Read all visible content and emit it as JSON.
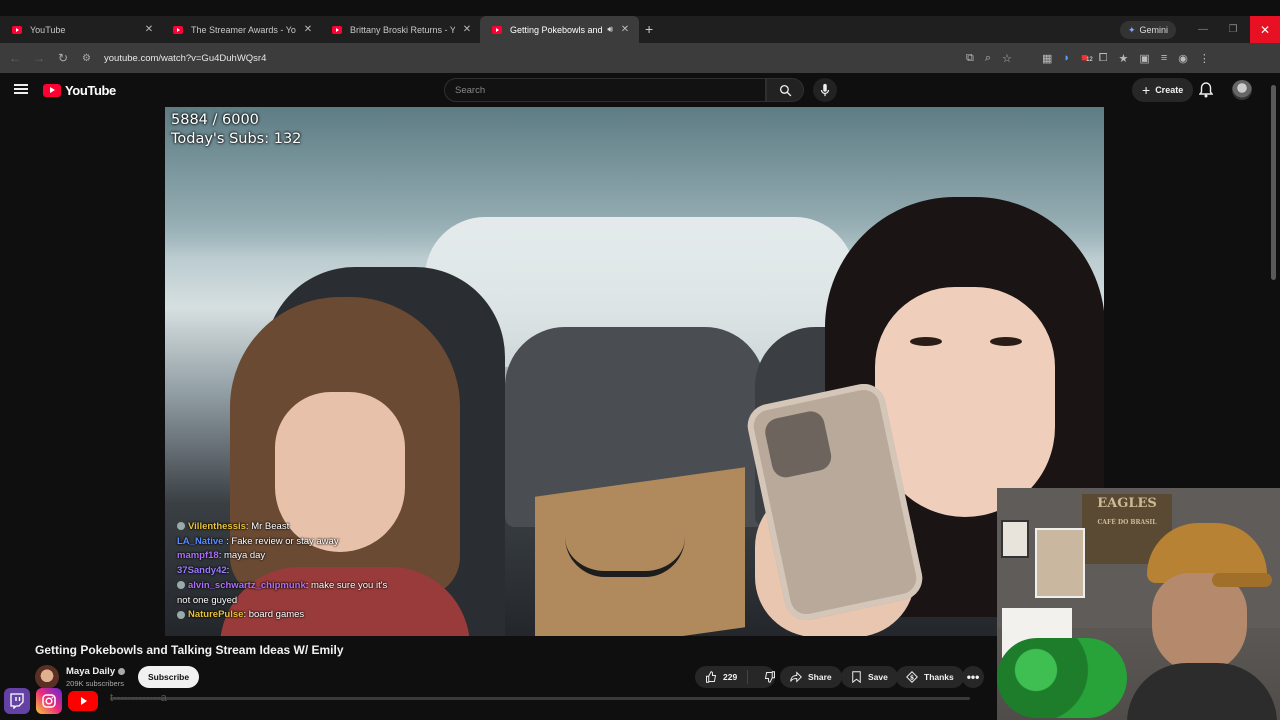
{
  "browser": {
    "tabs": [
      {
        "title": "YouTube",
        "active": false
      },
      {
        "title": "The Streamer Awards - YouTube",
        "active": false
      },
      {
        "title": "Brittany Broski Returns - YouTube",
        "active": false
      },
      {
        "title": "Getting Pokebowls and Talking",
        "active": true
      }
    ],
    "gemini_label": "Gemini",
    "url": "youtube.com/watch?v=Gu4DuhWQsr4",
    "extension_badge": "12"
  },
  "youtube": {
    "logo_text": "YouTube",
    "search_placeholder": "Search",
    "create_label": "Create"
  },
  "video": {
    "counter_line1": "5884 / 6000",
    "counter_line2": "Today's Subs: 132",
    "chat": [
      {
        "user": "Villenthessis",
        "text": "Mr Beast",
        "color": "#e7c23a"
      },
      {
        "user": "LA_Native",
        "text": "Fake review or stay away",
        "color": "#5b8cff"
      },
      {
        "user": "mampf18",
        "text": "maya day",
        "color": "#b06cff"
      },
      {
        "user": "37Sandy42",
        "text": "",
        "color": "#9b7cff"
      },
      {
        "user": "alvin_schwartz_chipmunk",
        "text": "make sure you it's not one guyed",
        "color": "#b06cff"
      },
      {
        "user": "NaturePulse",
        "text": "board games",
        "color": "#e7c23a"
      }
    ],
    "webcam_sign_top": "EAGLES",
    "webcam_sign_bottom": "CAFÉ DO BRASIL"
  },
  "info": {
    "title": "Getting Pokebowls and Talking Stream Ideas W/ Emily",
    "channel": "Maya Daily",
    "subscribers": "209K subscribers",
    "subscribe_label": "Subscribe",
    "likes": "229",
    "share_label": "Share",
    "save_label": "Save",
    "thanks_label": "Thanks",
    "ticker_text": "t-------------a"
  }
}
